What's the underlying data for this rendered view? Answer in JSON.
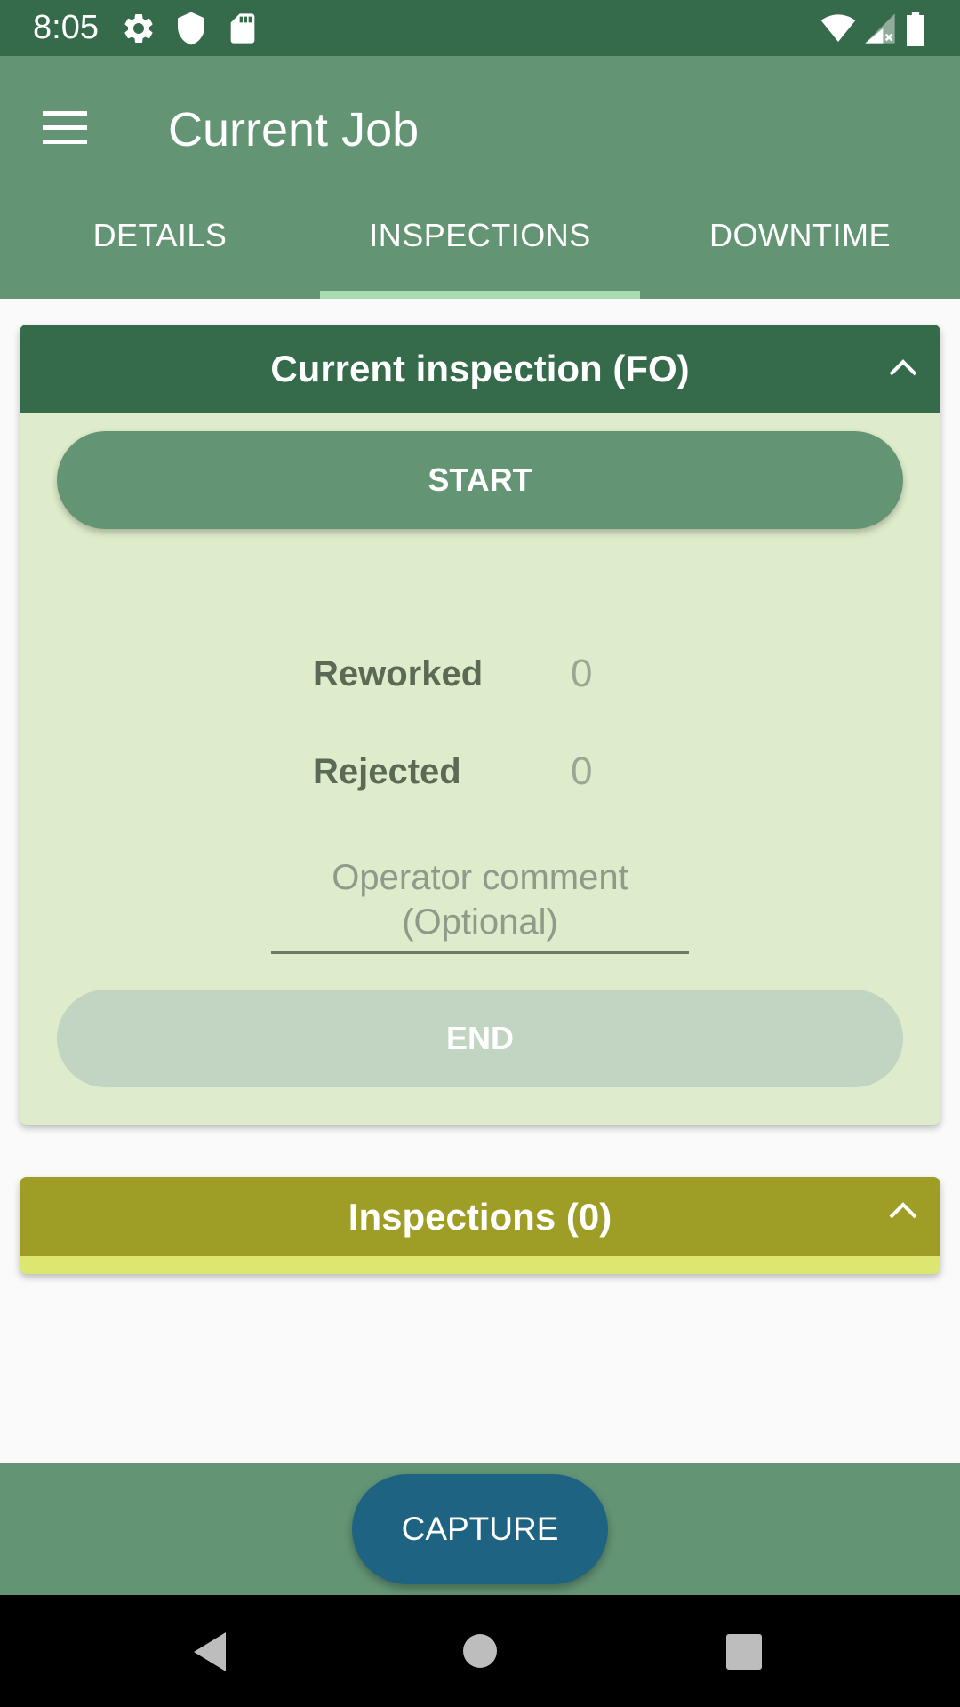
{
  "status_bar": {
    "time": "8:05",
    "left_icons": [
      "settings-icon",
      "shield-icon",
      "sd-card-icon"
    ],
    "right_icons": [
      "wifi-icon",
      "signal-icon",
      "battery-icon"
    ]
  },
  "app_bar": {
    "title": "Current Job",
    "menu_icon": "hamburger-menu-icon"
  },
  "tabs": [
    {
      "label": "DETAILS",
      "selected": false
    },
    {
      "label": "INSPECTIONS",
      "selected": true
    },
    {
      "label": "DOWNTIME",
      "selected": false
    }
  ],
  "current_inspection": {
    "title": "Current inspection (FO)",
    "start_label": "START",
    "reworked_label": "Reworked",
    "reworked_value": "0",
    "rejected_label": "Rejected",
    "rejected_value": "0",
    "comment_placeholder": "Operator comment (Optional)",
    "end_label": "END"
  },
  "inspections": {
    "title": "Inspections (0)"
  },
  "bottom": {
    "capture_label": "CAPTURE"
  },
  "colors": {
    "status_bar": "#356a4b",
    "app_bar": "#639575",
    "tab_indicator": "#a8dbb0",
    "card_body": "#deeccb",
    "card_header": "#356a4b",
    "end_disabled": "#c1d5c2",
    "inspections_header": "#9e9e26",
    "inspections_accent": "#dce670",
    "capture_button": "#1f6383"
  }
}
